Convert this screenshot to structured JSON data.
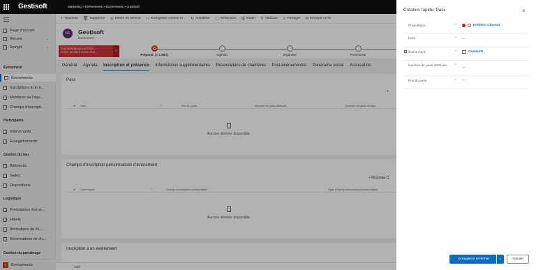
{
  "app": {
    "brand": "Gestisoft",
    "breadcrumb": "Marketing  >  Événements  >  Événements  >  Gestisoft"
  },
  "sidebar": {
    "top_items": [
      {
        "label": "Page d'accueil"
      },
      {
        "label": "Récent"
      },
      {
        "label": "Épinglé"
      }
    ],
    "sections": [
      {
        "header": "Événement",
        "items": [
          "Événements",
          "Inscriptions à un é...",
          "Membres de l'équ...",
          "Champs d'inscripti..."
        ]
      },
      {
        "header": "Participants",
        "items": [
          "Intervenants",
          "Enregistrements"
        ]
      },
      {
        "header": "Gestion du lieu",
        "items": [
          "Bâtiments",
          "Salles",
          "Dispositions"
        ]
      },
      {
        "header": "Logistique",
        "items": [
          "Prestataires événe...",
          "Hôtels",
          "Attributions de ch...",
          "Réservations de ch..."
        ]
      },
      {
        "header": "Gestion du parrainage",
        "items": []
      }
    ],
    "area": {
      "badge": "E",
      "label": "Événements"
    }
  },
  "commands": [
    "Nouveau",
    "Supprimer",
    "Mettre en service",
    "Enregistrer comme m...",
    "Actualiser",
    "Désactiver",
    "Traiter",
    "Attribuer",
    "Partager",
    "Envoyer un lie"
  ],
  "record": {
    "initials": "GE",
    "title": "Gestisoft",
    "entity": "Événement"
  },
  "bpf": {
    "active_process": "EventMainBusinessProce...",
    "active_note": "Active pendant moins d'un...",
    "stages": [
      {
        "label": "Préparat. (< 1 Min)",
        "active": true
      },
      {
        "label": "Agenda"
      },
      {
        "label": "Organiser"
      },
      {
        "label": "Promouvoir"
      }
    ]
  },
  "tabs": [
    "Général",
    "Agenda",
    "Inscription et présence",
    "Informations supplémentaires",
    "Réservations de chambres",
    "Post-événementiel",
    "Panorama social",
    "Association"
  ],
  "pass_card": {
    "title": "Pass",
    "cols": [
      "Nom",
      "Prix du pass",
      "Nombre de pass attribués",
      "Nombre de pass vendus"
    ],
    "empty": "Aucune donnée disponible.",
    "new": "+"
  },
  "custom_card": {
    "title": "Champs d'inscription personnalisés d'événement",
    "cols": [
      "Commande",
      "Champ d'inscription personnalisé",
      "Type (Champ d'inscription personnalisé)"
    ],
    "empty": "Aucune donnée disponible.",
    "new": "+  Nouveau C"
  },
  "reg_card": {
    "title": "Inscription à un événement"
  },
  "status": "Actif",
  "quick_create": {
    "title": "Création rapide: Pass",
    "fields": [
      {
        "label": "Propriétaire",
        "value": "Frédéric Charest"
      },
      {
        "label": "Nom",
        "value": "---"
      },
      {
        "label": "Événement",
        "value": "Gestisoft"
      },
      {
        "label": "Nombre de pass attribués",
        "value": "---"
      },
      {
        "label": "Prix du pass",
        "value": "---"
      }
    ],
    "required_mark": "*",
    "save_label": "Enregistrer et fermer",
    "cancel_label": "Annuler"
  }
}
